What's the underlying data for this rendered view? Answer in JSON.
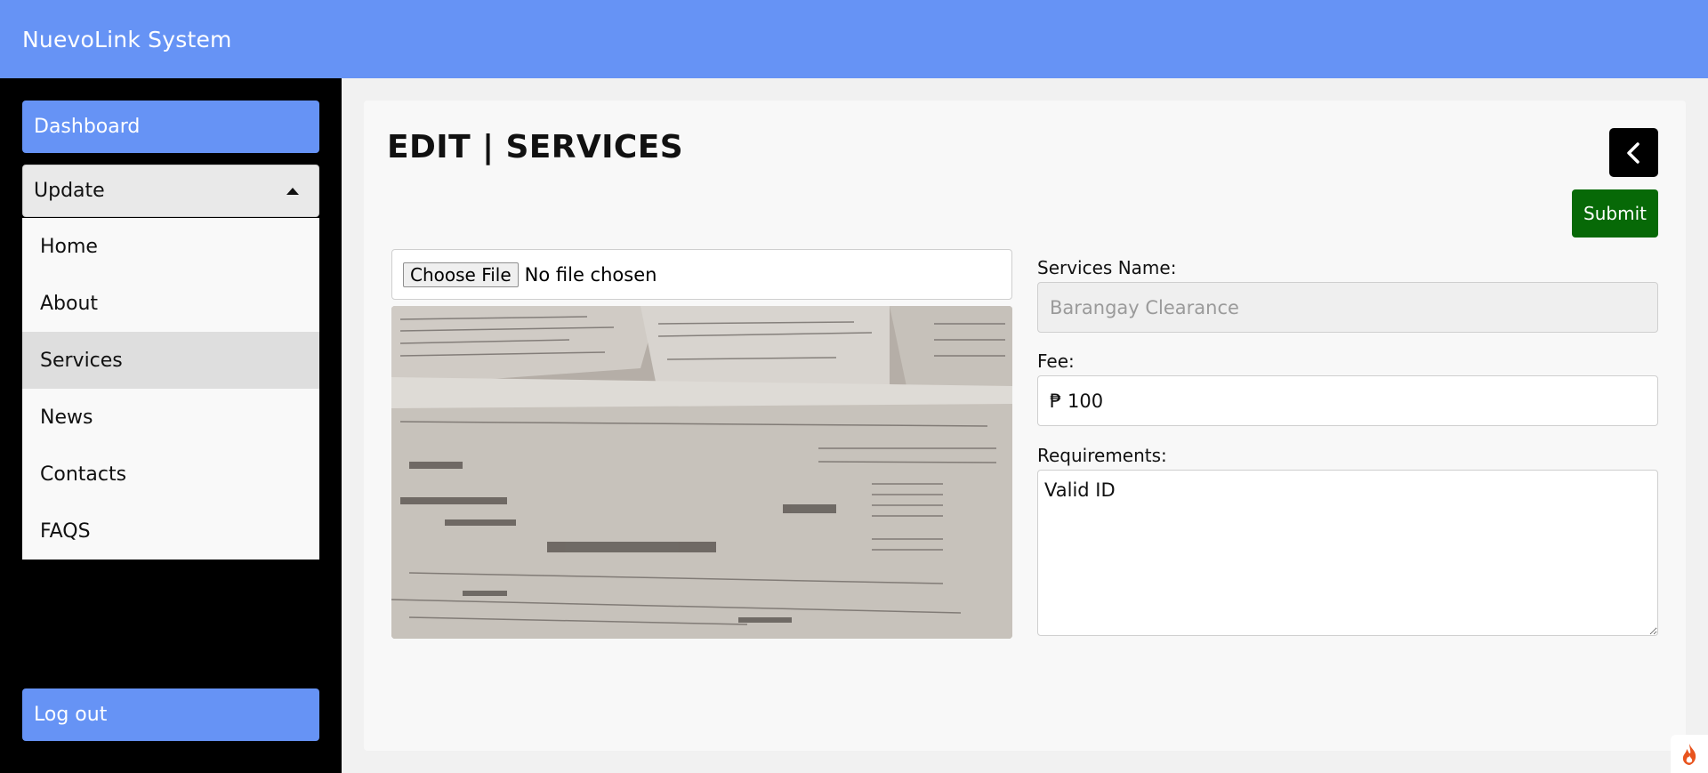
{
  "app": {
    "title": "NuevoLink System"
  },
  "sidebar": {
    "dashboard_label": "Dashboard",
    "dropdown": {
      "label": "Update",
      "items": [
        {
          "label": "Home"
        },
        {
          "label": "About"
        },
        {
          "label": "Services",
          "active": true
        },
        {
          "label": "News"
        },
        {
          "label": "Contacts"
        },
        {
          "label": "FAQS"
        }
      ]
    },
    "logout_label": "Log out"
  },
  "main": {
    "title": "EDIT | SERVICES",
    "submit_label": "Submit",
    "file_input": {
      "button_label": "Choose File",
      "status": "No file chosen"
    },
    "form": {
      "service_name": {
        "label": "Services Name:",
        "value": "Barangay Clearance"
      },
      "fee": {
        "label": "Fee:",
        "value": "₱ 100"
      },
      "requirements": {
        "label": "Requirements:",
        "value": "Valid ID"
      }
    }
  },
  "colors": {
    "topbar": "#6693f5",
    "sidebar": "#000000",
    "submit": "#076907",
    "active_menu": "#dedede"
  },
  "icons": {
    "back": "chevron-left-icon",
    "dropdown_caret": "caret-up-icon",
    "corner": "flame-icon"
  }
}
